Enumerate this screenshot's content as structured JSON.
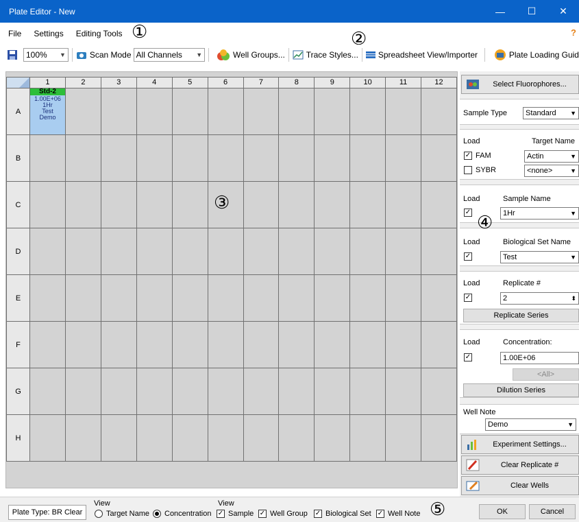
{
  "window": {
    "title": "Plate Editor - New",
    "minimize": "—",
    "maximize": "☐",
    "close": "✕"
  },
  "menu": {
    "items": [
      "File",
      "Settings",
      "Editing Tools"
    ],
    "help": "?"
  },
  "callouts": [
    "①",
    "②",
    "③",
    "④",
    "⑤"
  ],
  "toolbar": {
    "zoom": "100%",
    "scan_mode_label": "Scan Mode",
    "scan_mode_value": "All Channels",
    "well_groups": "Well Groups...",
    "trace_styles": "Trace Styles...",
    "spreadsheet": "Spreadsheet View/Importer",
    "plate_loading": "Plate Loading Guid"
  },
  "plate": {
    "columns": [
      "1",
      "2",
      "3",
      "4",
      "5",
      "6",
      "7",
      "8",
      "9",
      "10",
      "11",
      "12"
    ],
    "rows": [
      "A",
      "B",
      "C",
      "D",
      "E",
      "F",
      "G",
      "H"
    ],
    "selected_well": {
      "type": "Std-2",
      "concentration": "1.00E+06",
      "sample": "1Hr",
      "bioset": "Test",
      "note": "Demo"
    }
  },
  "panel": {
    "select_fluorophores": "Select Fluorophores...",
    "sample_type_label": "Sample Type",
    "sample_type_value": "Standard",
    "load_label": "Load",
    "target_name_label": "Target Name",
    "fam_label": "FAM",
    "fam_target": "Actin",
    "sybr_label": "SYBR",
    "sybr_target": "<none>",
    "sample_name_label": "Sample Name",
    "sample_name_value": "1Hr",
    "bioset_label": "Biological Set Name",
    "bioset_value": "Test",
    "replicate_label": "Replicate #",
    "replicate_value": "2",
    "replicate_series": "Replicate Series",
    "concentration_label": "Concentration:",
    "concentration_value": "1.00E+06",
    "all_label": "<All>",
    "dilution_series": "Dilution Series",
    "well_note_label": "Well Note",
    "well_note_value": "Demo",
    "experiment_settings": "Experiment Settings...",
    "clear_replicate": "Clear Replicate #",
    "clear_wells": "Clear Wells"
  },
  "status": {
    "plate_type": "Plate Type: BR Clear",
    "view_label": "View",
    "target_name": "Target Name",
    "concentration": "Concentration",
    "view2_label": "View",
    "sample": "Sample",
    "well_group": "Well Group",
    "biological_set": "Biological Set",
    "well_note": "Well Note",
    "ok": "OK",
    "cancel": "Cancel"
  }
}
